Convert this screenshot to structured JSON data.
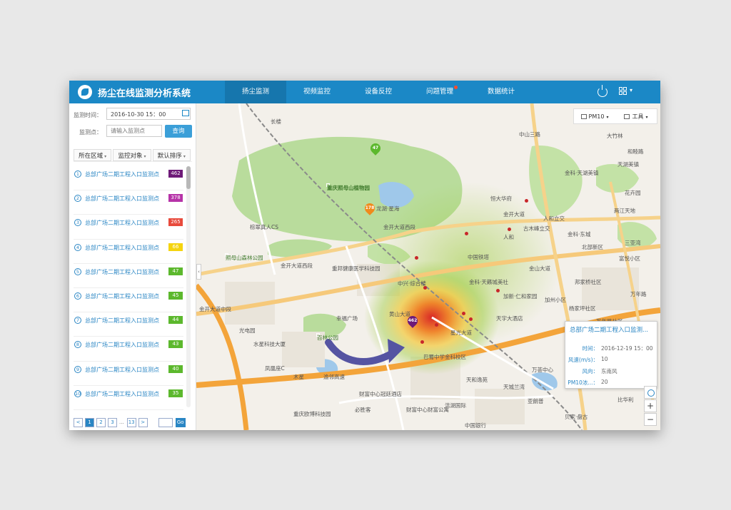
{
  "app": {
    "title": "扬尘在线监测分析系统"
  },
  "nav": [
    {
      "label": "扬尘监测",
      "active": true
    },
    {
      "label": "视频监控",
      "active": false
    },
    {
      "label": "设备反控",
      "active": false
    },
    {
      "label": "问题管理",
      "active": false,
      "badge": true
    },
    {
      "label": "数据统计",
      "active": false
    }
  ],
  "sidebar": {
    "time_label": "监测时间：",
    "time_value": "2016-10-30    15：00",
    "point_label": "监测点：",
    "point_placeholder": "请输入监测点",
    "query_label": "查询",
    "filters": [
      "所在区域",
      "监控对象",
      "默认排序"
    ],
    "items": [
      {
        "num": "1",
        "name": "总部广场二期工程入口监测点",
        "value": "462",
        "color": "#6e1a78"
      },
      {
        "num": "2",
        "name": "总部广场二期工程入口监测点",
        "value": "378",
        "color": "#b633a8"
      },
      {
        "num": "3",
        "name": "总部广场二期工程入口监测点",
        "value": "265",
        "color": "#e84a3c"
      },
      {
        "num": "4",
        "name": "总部广场二期工程入口监测点",
        "value": "66",
        "color": "#f5d40f"
      },
      {
        "num": "5",
        "name": "总部广场二期工程入口监测点",
        "value": "47",
        "color": "#5cb82d"
      },
      {
        "num": "6",
        "name": "总部广场二期工程入口监测点",
        "value": "45",
        "color": "#5cb82d"
      },
      {
        "num": "7",
        "name": "总部广场二期工程入口监测点",
        "value": "44",
        "color": "#5cb82d"
      },
      {
        "num": "8",
        "name": "总部广场二期工程入口监测点",
        "value": "43",
        "color": "#5cb82d"
      },
      {
        "num": "9",
        "name": "总部广场二期工程入口监测点",
        "value": "40",
        "color": "#5cb82d"
      },
      {
        "num": "10",
        "name": "总部广场二期工程入口监测点",
        "value": "35",
        "color": "#5cb82d"
      }
    ],
    "pager": {
      "prev": "<",
      "pages": [
        "1",
        "2",
        "3"
      ],
      "ellipsis": "...",
      "last": "13",
      "next": ">",
      "go": "Go"
    }
  },
  "map": {
    "tools": {
      "pollutant": "PM10",
      "tools": "工具"
    },
    "popup": {
      "title": "总部广场二期工程入口监测...",
      "rows": [
        {
          "k": "时间：",
          "v": "2016-12-19    15：00"
        },
        {
          "k": "风速(m/s)：",
          "v": "10"
        },
        {
          "k": "风向：",
          "v": "东南风"
        },
        {
          "k": "PM10浓...：",
          "v": "20"
        }
      ]
    },
    "markers": [
      {
        "value": "47",
        "color": "#5cb82d"
      },
      {
        "value": "178",
        "color": "#f08a1c"
      },
      {
        "value": "462",
        "color": "#6e1a78"
      }
    ],
    "labels": [
      "重庆照母山植物园",
      "龙湖·星海",
      "棕翠真人CS",
      "照母山森林公园",
      "金开大道西段",
      "金开大道西段",
      "重邦健康医学科技园",
      "中兴·综合楼",
      "金科·天籁城美社",
      "恒大华府",
      "人和",
      "古木峰立交",
      "金科·天湖美镇",
      "和睦路",
      "两江天地",
      "万年路",
      "富悦小区",
      "邦家桥社区",
      "杨家坪社区",
      "万年路社区",
      "金开大道中段",
      "光电园",
      "水星科技大厦",
      "幸福广场",
      "百林公园",
      "黄山大道",
      "巴蜀中学金科校区",
      "天宇大酒店",
      "凤凰座C",
      "木星",
      "渝邻高速",
      "财富中心冠廷酒店",
      "天和逸苑",
      "天城兰湾",
      "亚朗普",
      "贝家·盘古",
      "重庆欧博科技园",
      "必胜客",
      "财富中心财富公寓",
      "中国银行",
      "洪湖国际",
      "万荟中心",
      "比华利",
      "金科·东城",
      "加新·仁和家园",
      "楠竹坪",
      "中山三路",
      "花卉园",
      "金开大道",
      "人和立交",
      "金山大道",
      "大竹林",
      "天湖美镇",
      "三亚湾",
      "北部新区",
      "中国铁塔",
      "加州小区",
      "星光大道",
      "长楼"
    ]
  }
}
